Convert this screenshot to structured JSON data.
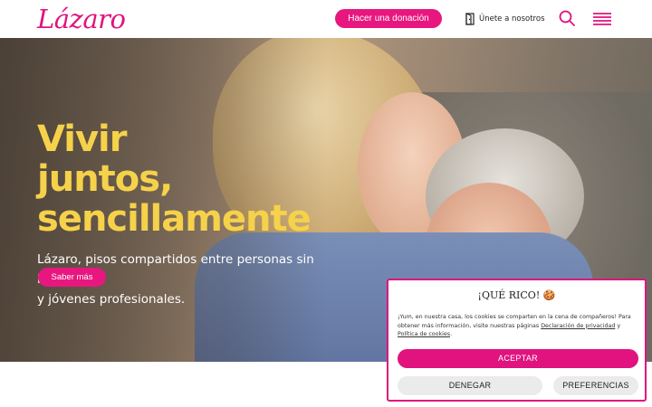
{
  "header": {
    "logo": "Lázaro",
    "donate_label": "Hacer una donación",
    "join_label": "Únete a nosotros",
    "join_icon": "door-icon",
    "search_icon": "search-icon",
    "menu_icon": "hamburger-menu-icon"
  },
  "hero": {
    "title_line1": "Vivir",
    "title_line2": "juntos,",
    "title_line3": "sencillamente",
    "subtitle_line1": "Lázaro, pisos compartidos entre personas sin hogar",
    "subtitle_line2": "y jóvenes profesionales.",
    "more_label": "Saber más"
  },
  "cookie_banner": {
    "title": "¡QUÉ RICO! 🍪",
    "text_before": "¡Yum, en nuestra casa, los cookies se comparten en la cena de compañeros! Para obtener más información, visite nuestras páginas ",
    "link_privacy": "Declaración de privacidad",
    "text_middle": " y ",
    "link_cookies": "Política de cookies",
    "text_after": ".",
    "accept_label": "ACEPTAR",
    "deny_label": "DENEGAR",
    "prefs_label": "PREFERENCIAS"
  },
  "colors": {
    "brand_pink": "#e0137f",
    "hero_yellow": "#f5d24a"
  }
}
